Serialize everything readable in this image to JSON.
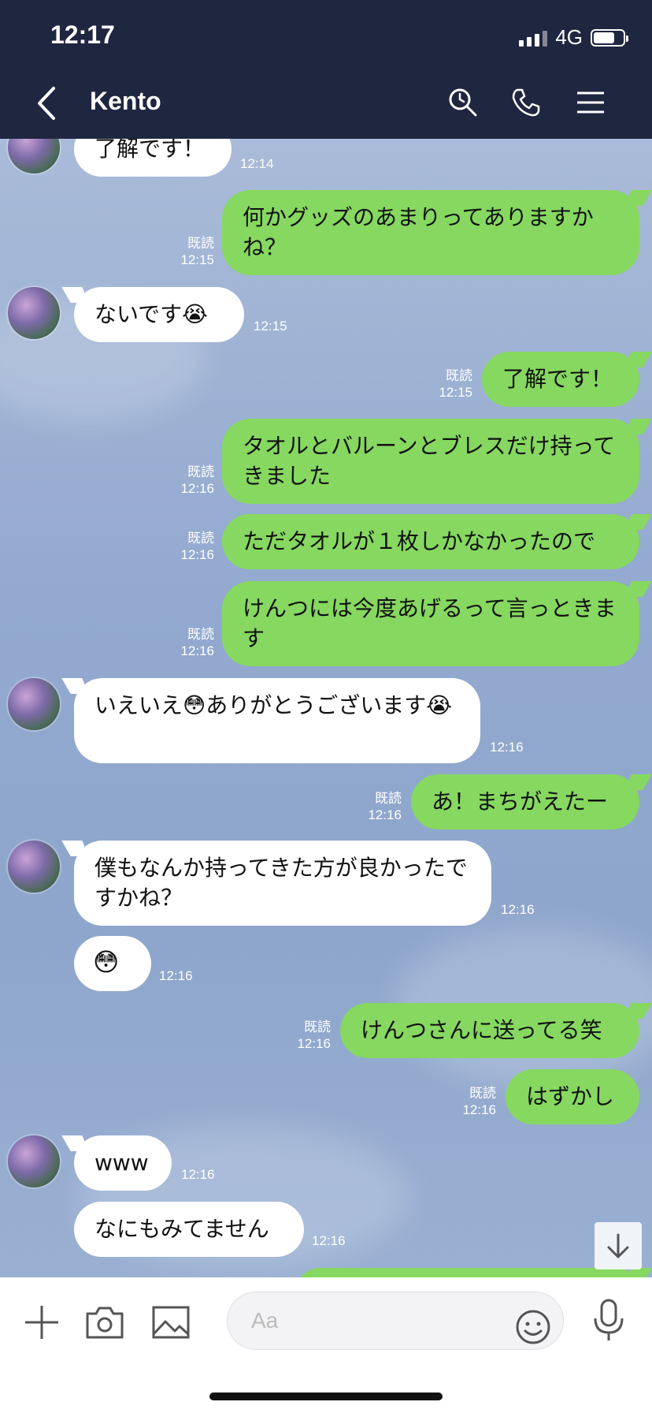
{
  "status": {
    "time": "12:17",
    "network": "4G",
    "battery_level": 0.64
  },
  "header": {
    "title": "Kento"
  },
  "messages": [
    {
      "text": "了解です！",
      "time": "12:14"
    },
    {
      "text": "何かグッズのあまりってありますかね？",
      "read": "既読",
      "time": "12:15"
    },
    {
      "text": "ないです😭",
      "time": "12:15"
    },
    {
      "text": "了解です！",
      "read": "既読",
      "time": "12:15"
    },
    {
      "text": "タオルとバルーンとブレスだけ持ってきました",
      "read": "既読",
      "time": "12:16"
    },
    {
      "text": "ただタオルが１枚しかなかったので",
      "read": "既読",
      "time": "12:16"
    },
    {
      "text": "けんつには今度あげるって言っときます",
      "read": "既読",
      "time": "12:16"
    },
    {
      "text": "いえいえ😳ありがとうございます😭",
      "time": "12:16"
    },
    {
      "text": "あ！まちがえたー",
      "read": "既読",
      "time": "12:16"
    },
    {
      "text": "僕もなんか持ってきた方が良かったですかね？",
      "time": "12:16"
    },
    {
      "text": "😳",
      "time": "12:16"
    },
    {
      "text": "けんつさんに送ってる笑",
      "read": "既読",
      "time": "12:16"
    },
    {
      "text": "はずかし",
      "read": "既読",
      "time": "12:16"
    },
    {
      "text": "www",
      "time": "12:16"
    },
    {
      "text": "なにもみてません",
      "time": "12:16"
    }
  ],
  "input": {
    "placeholder": "Aa"
  },
  "colors": {
    "header_bg": "#1f2640",
    "outgoing_bubble": "#86d860",
    "incoming_bubble": "#ffffff"
  },
  "icons": [
    "back-icon",
    "search-icon",
    "phone-icon",
    "menu-icon",
    "scroll-down-icon",
    "plus-icon",
    "camera-icon",
    "image-icon",
    "emoji-icon",
    "microphone-icon"
  ]
}
